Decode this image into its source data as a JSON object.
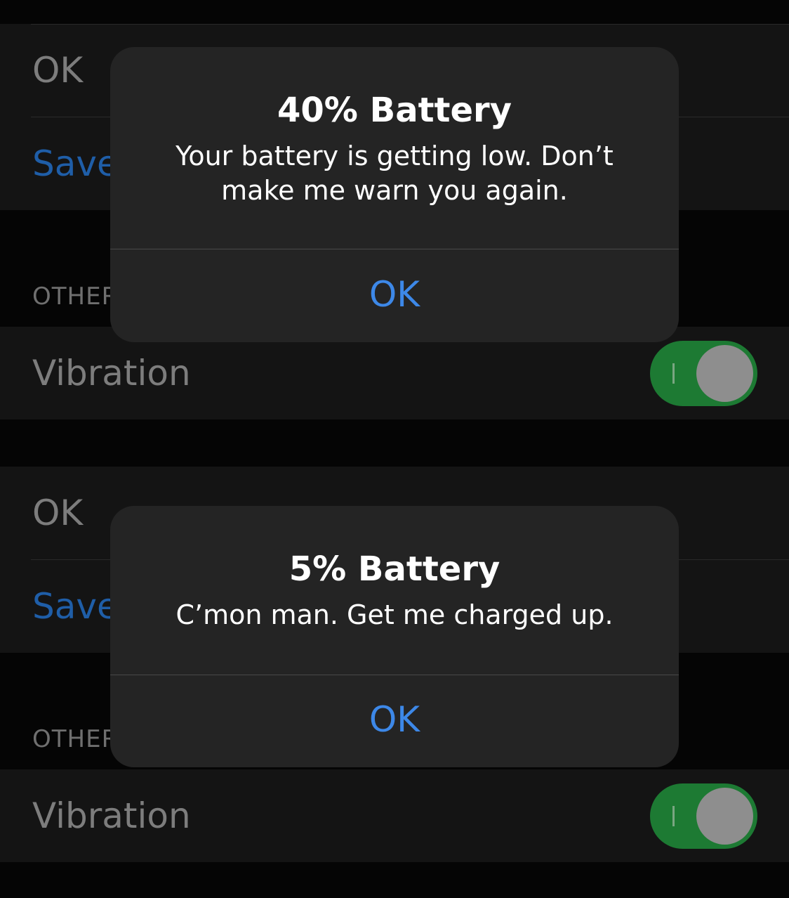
{
  "panels": [
    {
      "rows": {
        "ok_label": "OK",
        "save_label": "Save",
        "section_header": "OTHER",
        "vibration_label": "Vibration"
      },
      "vibration_toggle_on": true,
      "alert": {
        "title": "40% Battery",
        "message": "Your battery is getting low. Don’t make me warn you again.",
        "button_label": "OK"
      }
    },
    {
      "rows": {
        "ok_label": "OK",
        "save_label": "Save",
        "section_header": "OTHER",
        "vibration_label": "Vibration"
      },
      "vibration_toggle_on": true,
      "alert": {
        "title": "5% Battery",
        "message": "C’mon man. Get me charged up.",
        "button_label": "OK"
      }
    }
  ],
  "colors": {
    "background": "#050505",
    "row_background": "#141414",
    "alert_background": "#242424",
    "toggle_on": "#1d7a33",
    "link_blue": "#1f5ea8",
    "alert_button_blue": "#3d88e8"
  }
}
